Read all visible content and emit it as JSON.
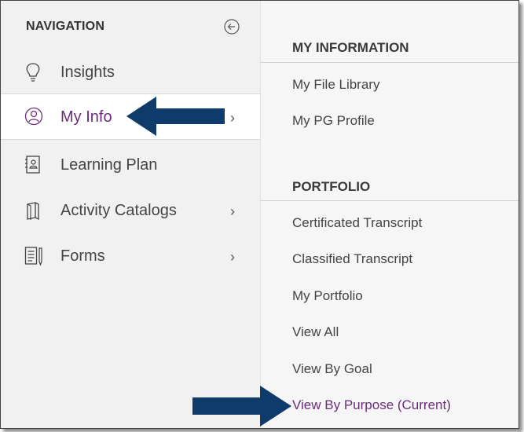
{
  "nav": {
    "title": "NAVIGATION",
    "items": [
      {
        "label": "Insights",
        "icon": "lightbulb-icon"
      },
      {
        "label": "My Info",
        "icon": "person-circle-icon",
        "chevron": "›"
      },
      {
        "label": "Learning Plan",
        "icon": "address-book-icon"
      },
      {
        "label": "Activity Catalogs",
        "icon": "book-icon",
        "chevron": "›"
      },
      {
        "label": "Forms",
        "icon": "form-icon",
        "chevron": "›"
      }
    ]
  },
  "submenu": {
    "sections": [
      {
        "title": "MY INFORMATION",
        "links": [
          "My File Library",
          "My PG Profile"
        ]
      },
      {
        "title": "PORTFOLIO",
        "links": [
          "Certificated Transcript",
          "Classified Transcript",
          "My Portfolio",
          "View All",
          "View By Goal",
          "View By Purpose (Current)"
        ]
      }
    ]
  },
  "colors": {
    "accent": "#6b2d7a",
    "arrow": "#0f3b6b",
    "nav_bg": "#f1f1f1"
  }
}
